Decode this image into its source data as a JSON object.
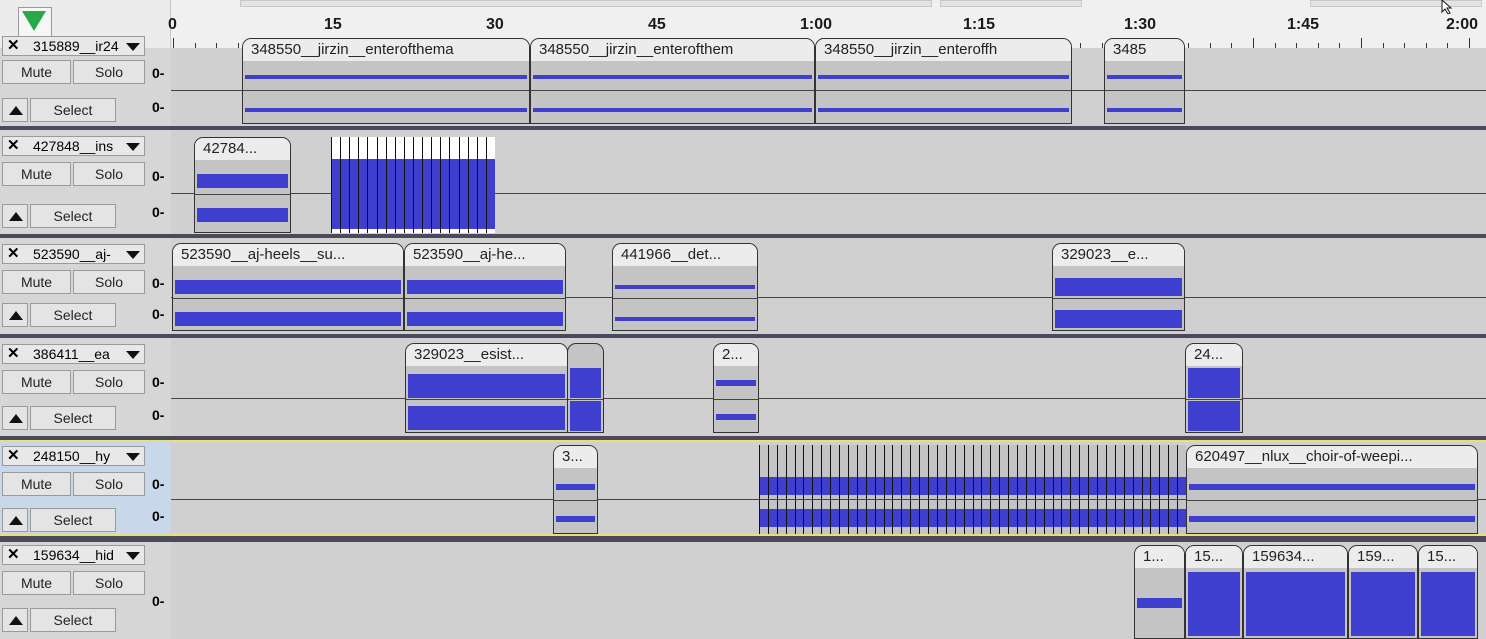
{
  "ruler": {
    "labels": [
      "0",
      "15",
      "30",
      "45",
      "1:00",
      "1:15",
      "1:30",
      "1:45",
      "2:00"
    ]
  },
  "tracks": [
    {
      "id": "t1",
      "name": "315889__ir24",
      "mute_label": "Mute",
      "solo_label": "Solo",
      "select_label": "Select",
      "scale_label": "0-",
      "clips": [
        {
          "title": "348550__jirzin__enterofthema"
        },
        {
          "title": "348550__jirzin__enterofthem"
        },
        {
          "title": "348550__jirzin__enteroffh"
        },
        {
          "title": "3485"
        }
      ]
    },
    {
      "id": "t2",
      "name": "427848__ins",
      "mute_label": "Mute",
      "solo_label": "Solo",
      "select_label": "Select",
      "scale_label": "0-",
      "clips": [
        {
          "title": "42784..."
        }
      ]
    },
    {
      "id": "t3",
      "name": "523590__aj-",
      "mute_label": "Mute",
      "solo_label": "Solo",
      "select_label": "Select",
      "scale_label": "0-",
      "clips": [
        {
          "title": "523590__aj-heels__su..."
        },
        {
          "title": "523590__aj-he..."
        },
        {
          "title": "441966__det..."
        },
        {
          "title": "329023__e..."
        }
      ]
    },
    {
      "id": "t4",
      "name": "386411__ea",
      "mute_label": "Mute",
      "solo_label": "Solo",
      "select_label": "Select",
      "scale_label": "0-",
      "clips": [
        {
          "title": "329023__esist..."
        },
        {
          "title": "2..."
        },
        {
          "title": "24..."
        }
      ]
    },
    {
      "id": "t5",
      "name": "248150__hy",
      "mute_label": "Mute",
      "solo_label": "Solo",
      "select_label": "Select",
      "scale_label": "0-",
      "clips": [
        {
          "title": "3..."
        },
        {
          "title": "620497__nlux__choir-of-weepi..."
        }
      ]
    },
    {
      "id": "t6",
      "name": "159634__hid",
      "mute_label": "Mute",
      "solo_label": "Solo",
      "select_label": "Select",
      "scale_label": "0-",
      "clips": [
        {
          "title": "1..."
        },
        {
          "title": "15..."
        },
        {
          "title": "159634..."
        },
        {
          "title": "159..."
        },
        {
          "title": "15..."
        }
      ]
    }
  ],
  "colors": {
    "waveform": "#3f3fcf",
    "play_indicator": "#27a84a",
    "selected_track_border": "#e6e07a"
  },
  "icons": {
    "play_position": "green-down-triangle",
    "close": "x-icon",
    "menu": "dropdown-triangle-icon",
    "collapse": "up-triangle-icon",
    "cursor": "mouse-pointer-icon"
  }
}
